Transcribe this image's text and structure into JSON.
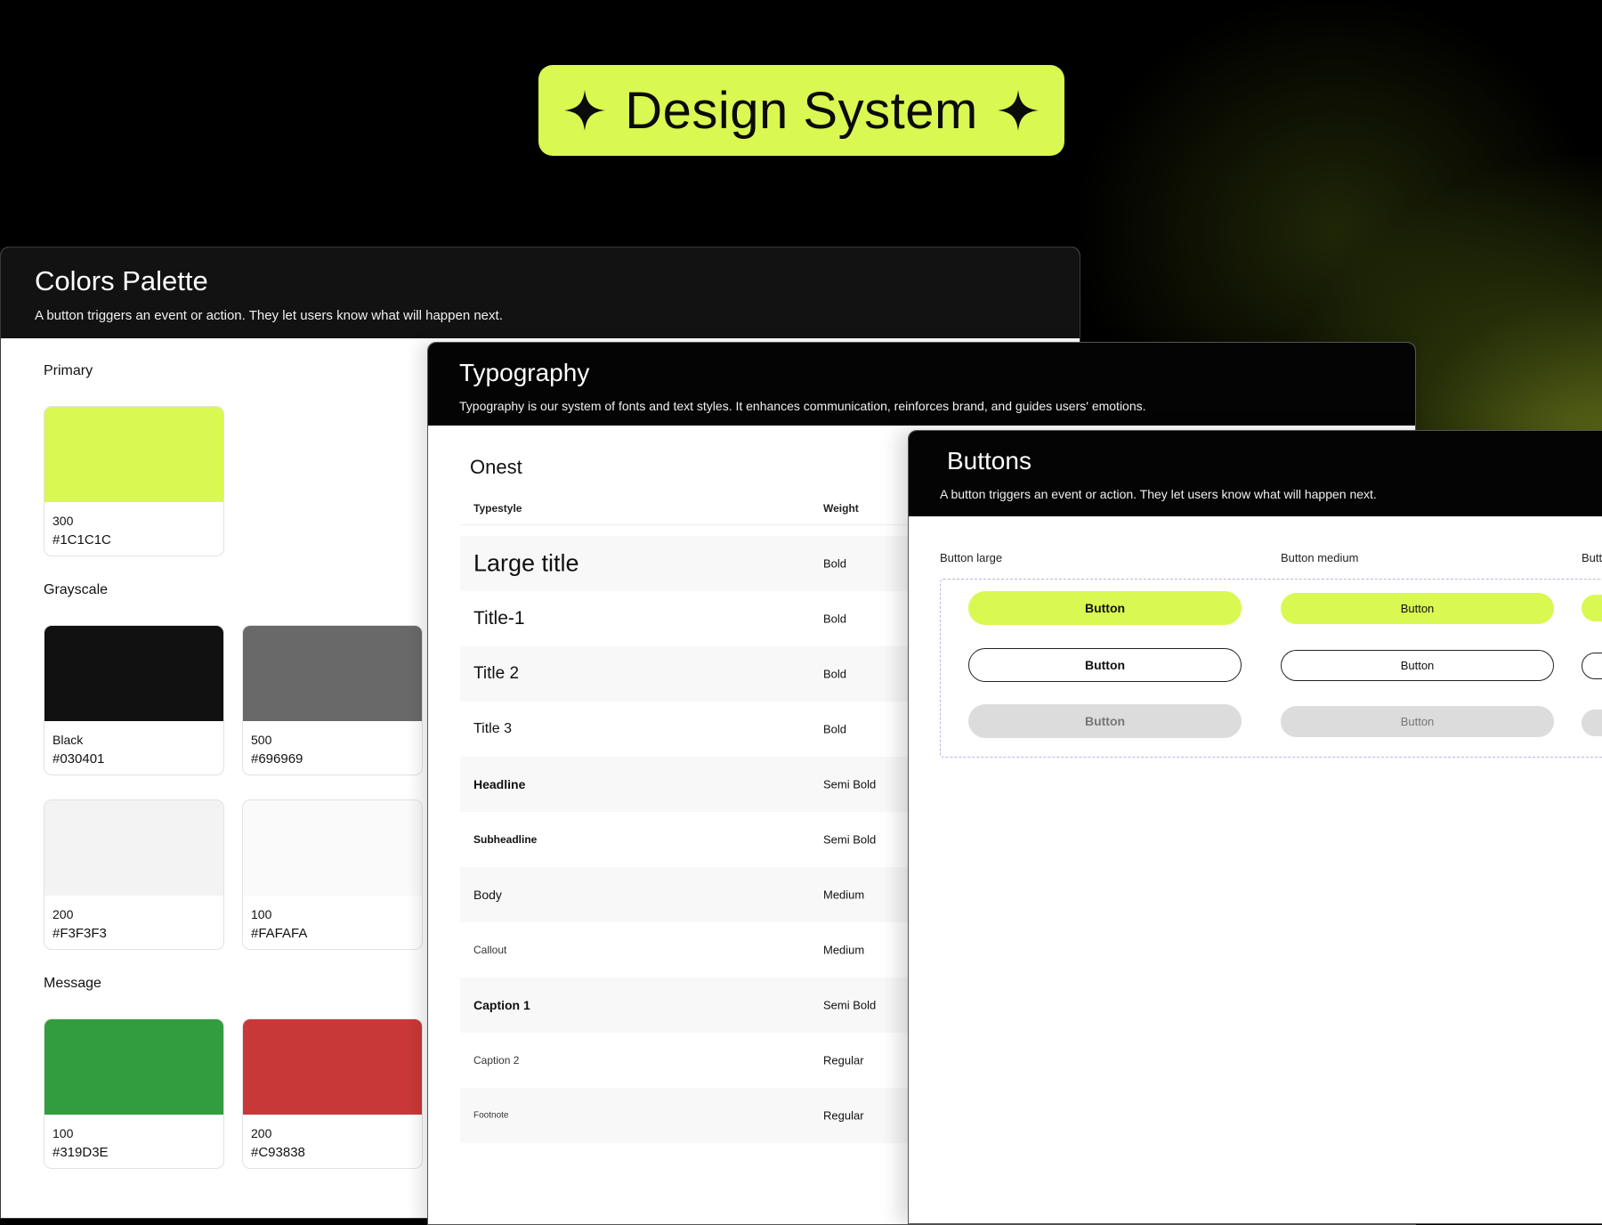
{
  "hero": {
    "title": "Design System",
    "accent": "#D9F852"
  },
  "colors_panel": {
    "title": "Colors Palette",
    "subtitle": "A button triggers an event or action. They let users know what will happen next.",
    "sections": {
      "primary": {
        "label": "Primary",
        "swatches": [
          {
            "name": "300",
            "hex": "#1C1C1C",
            "color": "#D9F852"
          }
        ]
      },
      "grayscale": {
        "label": "Grayscale",
        "swatches": [
          {
            "name": "Black",
            "hex": "#030401",
            "color": "#111111"
          },
          {
            "name": "500",
            "hex": "#696969",
            "color": "#696969"
          },
          {
            "name": "200",
            "hex": "#F3F3F3",
            "color": "#F3F3F3"
          },
          {
            "name": "100",
            "hex": "#FAFAFA",
            "color": "#FAFAFA"
          }
        ]
      },
      "message": {
        "label": "Message",
        "swatches": [
          {
            "name": "100",
            "hex": "#319D3E",
            "color": "#319D3E"
          },
          {
            "name": "200",
            "hex": "#C93838",
            "color": "#C93838"
          }
        ]
      }
    }
  },
  "typography_panel": {
    "title": "Typography",
    "subtitle": "Typography is our system of fonts and text styles. It enhances communication, reinforces brand, and guides users' emotions.",
    "font_name": "Onest",
    "headers": {
      "typestyle": "Typestyle",
      "weight": "Weight"
    },
    "rows": [
      {
        "style": "Large title",
        "weight": "Bold"
      },
      {
        "style": "Title-1",
        "weight": "Bold"
      },
      {
        "style": "Title 2",
        "weight": "Bold"
      },
      {
        "style": "Title 3",
        "weight": "Bold"
      },
      {
        "style": "Headline",
        "weight": "Semi Bold"
      },
      {
        "style": "Subheadline",
        "weight": "Semi Bold"
      },
      {
        "style": "Body",
        "weight": "Medium"
      },
      {
        "style": "Callout",
        "weight": "Medium"
      },
      {
        "style": "Caption 1",
        "weight": "Semi Bold"
      },
      {
        "style": "Caption 2",
        "weight": "Regular"
      },
      {
        "style": "Footnote",
        "weight": "Regular"
      }
    ]
  },
  "buttons_panel": {
    "title": "Buttons",
    "subtitle": "A button triggers an event or action. They let users know what will happen next.",
    "columns": [
      "Button large",
      "Button medium",
      "Butt"
    ],
    "button_label": "Button"
  }
}
